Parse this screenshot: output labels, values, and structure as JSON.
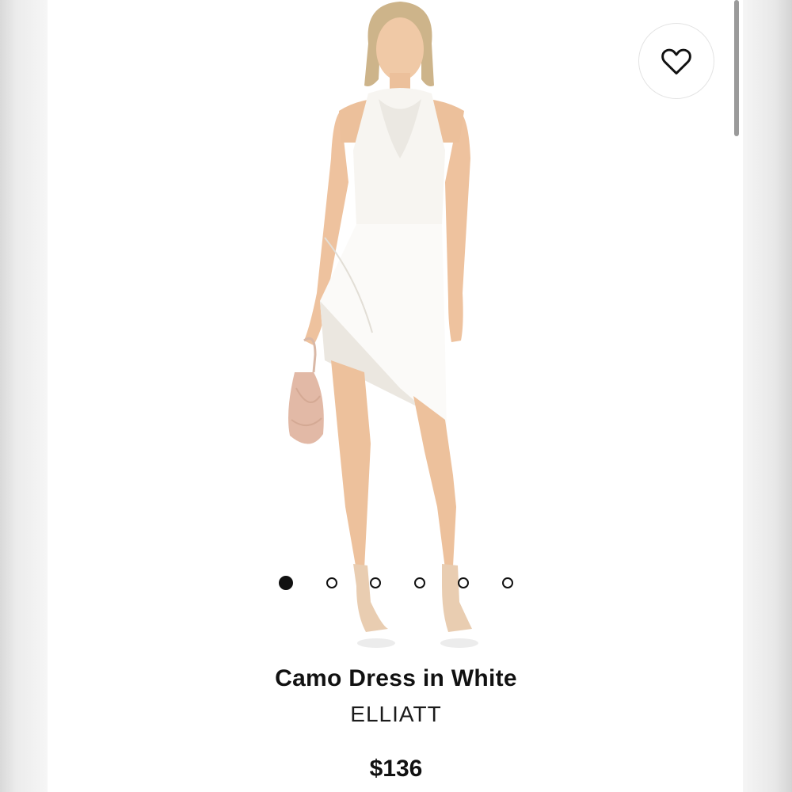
{
  "product": {
    "title": "Camo Dress in White",
    "brand": "ELLIATT",
    "price": "$136"
  },
  "carousel": {
    "total_images": 6,
    "active_index": 0
  },
  "icons": {
    "favorite": "heart-outline-icon"
  },
  "colors": {
    "text": "#111111",
    "background": "#ffffff",
    "dot_active": "#111111"
  }
}
